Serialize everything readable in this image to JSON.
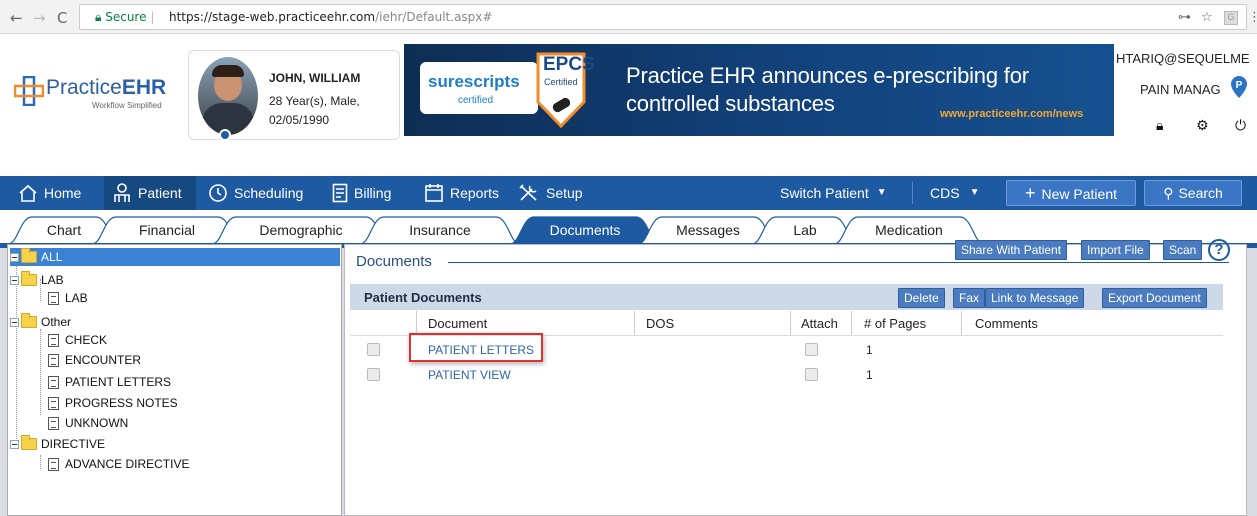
{
  "browser": {
    "back_icon": "←",
    "forward_icon": "→",
    "reload_icon": "C",
    "secure_label": "Secure",
    "url_host": "https://stage-web.practiceehr.com",
    "url_path": "/iehr/Default.aspx#",
    "key_icon": "⊶",
    "star_icon": "☆",
    "ext_label": "G",
    "menu_icon": "⋮"
  },
  "logo": {
    "name_a": "Practice",
    "name_b": "EHR",
    "tagline": "Workflow Simplified"
  },
  "patient": {
    "name": "JOHN, WILLIAM",
    "info": "28 Year(s), Male,",
    "dob": "02/05/1990"
  },
  "banner": {
    "surescripts": "surescripts",
    "certified": "certified",
    "epcs_title": "EPCS",
    "epcs_sub": "Certified",
    "headline": "Practice EHR announces e-prescribing for controlled substances",
    "link": "www.practiceehr.com/news"
  },
  "header": {
    "user": "HTARIQ@SEQUELME",
    "clinic": "PAIN MANAG"
  },
  "menu": {
    "home": "Home",
    "patient": "Patient",
    "scheduling": "Scheduling",
    "billing": "Billing",
    "reports": "Reports",
    "setup": "Setup",
    "switch_patient": "Switch Patient",
    "cds": "CDS",
    "new_patient": "New Patient",
    "search": "Search"
  },
  "tabs": [
    "Chart",
    "Financial",
    "Demographic",
    "Insurance",
    "Documents",
    "Messages",
    "Lab",
    "Medication"
  ],
  "tree": {
    "all": "ALL",
    "lab": "LAB",
    "lab_child": "LAB",
    "other": "Other",
    "other_children": [
      "CHECK",
      "ENCOUNTER",
      "PATIENT LETTERS",
      "PROGRESS NOTES",
      "UNKNOWN"
    ],
    "directive": "DIRECTIVE",
    "directive_child": "ADVANCE DIRECTIVE"
  },
  "documents": {
    "title": "Documents",
    "share_button": "Share With Patient",
    "import_button": "Import File",
    "scan_button": "Scan",
    "help_icon": "?",
    "panel_title": "Patient Documents",
    "delete_button": "Delete",
    "fax_button": "Fax",
    "link_button": "Link to Message",
    "export_button": "Export Document",
    "columns": [
      "Document",
      "DOS",
      "Attach",
      "# of Pages",
      "Comments"
    ],
    "rows": [
      {
        "document": "PATIENT LETTERS",
        "dos": "",
        "pages": "1",
        "comments": ""
      },
      {
        "document": "PATIENT VIEW",
        "dos": "",
        "pages": "1",
        "comments": ""
      }
    ]
  },
  "colors": {
    "nav_blue": "#1d5aa2",
    "highlight_red": "#e03030",
    "link_blue": "#2f65a8"
  }
}
